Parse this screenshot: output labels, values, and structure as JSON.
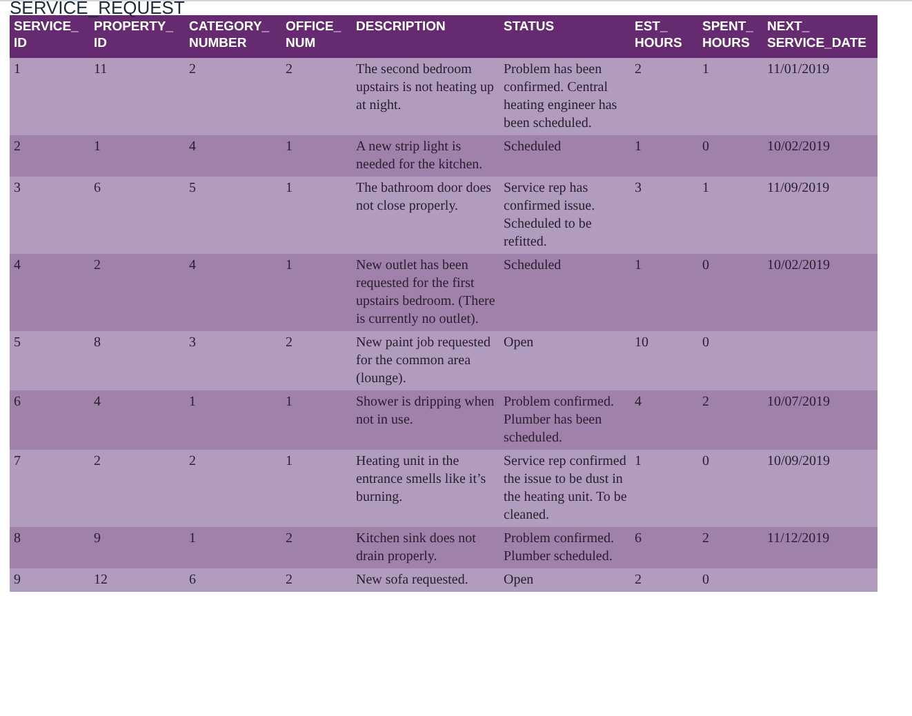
{
  "title": "SERVICE_REQUEST",
  "table": {
    "columns": [
      "SERVICE_ ID",
      "PROPERTY_ ID",
      "CATEGORY_ NUMBER",
      "OFFICE_ NUM",
      "DESCRIPTION",
      "STATUS",
      "EST_ HOURS",
      "SPENT_ HOURS",
      "NEXT_ SERVICE_DATE"
    ],
    "rows": [
      [
        "1",
        "11",
        "2",
        "2",
        "The second bedroom upstairs is not heating up at night.",
        "Problem has been confirmed. Central heating engineer has been scheduled.",
        "2",
        "1",
        "11/01/2019"
      ],
      [
        "2",
        "1",
        "4",
        "1",
        "A new strip light is needed for the kitchen.",
        "Scheduled",
        "1",
        "0",
        "10/02/2019"
      ],
      [
        "3",
        "6",
        "5",
        "1",
        "The bathroom door does not close properly.",
        "Service rep has confirmed issue. Scheduled to be refitted.",
        "3",
        "1",
        "11/09/2019"
      ],
      [
        "4",
        "2",
        "4",
        "1",
        "New outlet has been requested for the first upstairs bedroom. (There is currently no outlet).",
        "Scheduled",
        "1",
        "0",
        "10/02/2019"
      ],
      [
        "5",
        "8",
        "3",
        "2",
        "New paint job requested for the common area (lounge).",
        "Open",
        "10",
        "0",
        ""
      ],
      [
        "6",
        "4",
        "1",
        "1",
        "Shower is dripping when not in use.",
        "Problem confirmed. Plumber has been scheduled.",
        "4",
        "2",
        "10/07/2019"
      ],
      [
        "7",
        "2",
        "2",
        "1",
        "Heating unit in the entrance smells like it’s burning.",
        "Service rep confirmed the issue to be dust in the heating unit. To be cleaned.",
        "1",
        "0",
        "10/09/2019"
      ],
      [
        "8",
        "9",
        "1",
        "2",
        "Kitchen sink does not drain properly.",
        "Problem confirmed. Plumber scheduled.",
        "6",
        "2",
        "11/12/2019"
      ],
      [
        "9",
        "12",
        "6",
        "2",
        "New sofa requested.",
        "Open",
        "2",
        "0",
        ""
      ]
    ]
  }
}
